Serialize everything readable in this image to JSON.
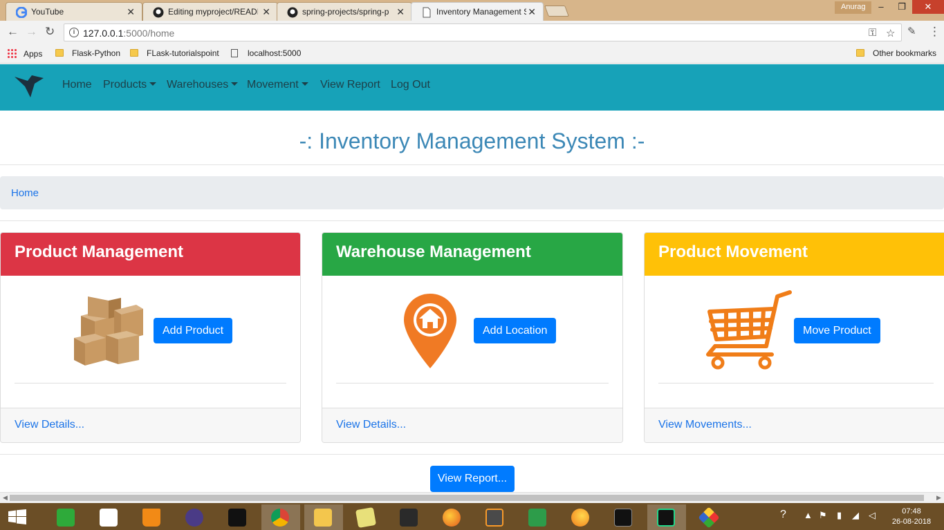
{
  "browser": {
    "tabs": [
      {
        "title": "YouTube",
        "icon": "google-icon",
        "active": false
      },
      {
        "title": "Editing myproject/READM",
        "icon": "github-icon",
        "active": false
      },
      {
        "title": "spring-projects/spring-p",
        "icon": "github-icon",
        "active": false
      },
      {
        "title": "Inventory Management S",
        "icon": "page-icon",
        "active": true
      }
    ],
    "profile_name": "Anurag",
    "url_host": "127.0.0.1",
    "url_path": ":5000/home",
    "bookmarks": [
      {
        "label": "Apps",
        "icon": "apps-grid-icon"
      },
      {
        "label": "Flask-Python",
        "icon": "folder-icon"
      },
      {
        "label": "FLask-tutorialspoint",
        "icon": "folder-icon"
      },
      {
        "label": "localhost:5000",
        "icon": "page-icon"
      }
    ],
    "other_bookmarks": "Other bookmarks"
  },
  "navbar": {
    "color": "#17a2b8",
    "items": [
      {
        "label": "Home",
        "dropdown": false
      },
      {
        "label": "Products",
        "dropdown": true
      },
      {
        "label": "Warehouses",
        "dropdown": true
      },
      {
        "label": "Movement",
        "dropdown": true
      },
      {
        "label": "View Report",
        "dropdown": false
      },
      {
        "label": "Log Out",
        "dropdown": false
      }
    ]
  },
  "page": {
    "title": "-: Inventory Management System :-",
    "breadcrumb": "Home",
    "report_button": "View Report..."
  },
  "cards": [
    {
      "header": "Product Management",
      "color": "#dc3545",
      "icon": "boxes-icon",
      "button": "Add Product",
      "footer_link": "View Details..."
    },
    {
      "header": "Warehouse Management",
      "color": "#28a745",
      "icon": "location-pin-home-icon",
      "button": "Add Location",
      "footer_link": "View Details..."
    },
    {
      "header": "Product Movement",
      "color": "#ffc107",
      "icon": "shopping-cart-icon",
      "button": "Move Product",
      "footer_link": "View Movements..."
    }
  ],
  "taskbar": {
    "time": "07:48",
    "date": "26-08-2018"
  }
}
